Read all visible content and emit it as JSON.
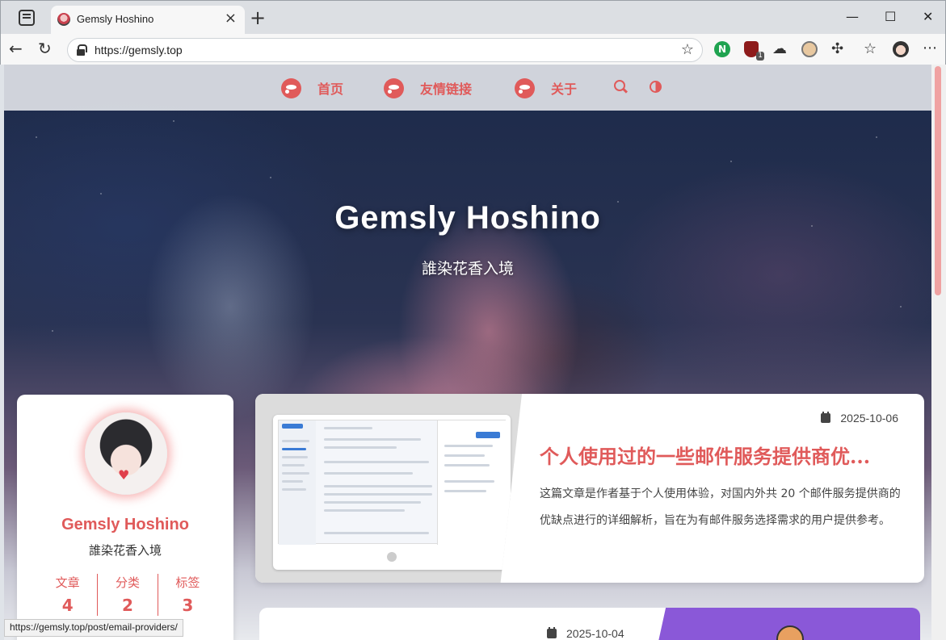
{
  "browser": {
    "tab_title": "Gemsly Hoshino",
    "url": "https://gemsly.top",
    "status_url": "https://gemsly.top/post/email-providers/",
    "ublock_count": "1",
    "icons": [
      "tab-actions-icon",
      "close-icon",
      "plus-icon",
      "minimize-icon",
      "maximize-icon",
      "close-window-icon",
      "back-icon",
      "reload-icon",
      "lock-icon",
      "star-icon",
      "extensions-icon",
      "favorites-icon",
      "more-icon"
    ]
  },
  "nav": {
    "items": [
      {
        "label": "首页"
      },
      {
        "label": "友情链接"
      },
      {
        "label": "关于"
      }
    ],
    "accent": "#e05a5a"
  },
  "hero": {
    "title": "Gemsly Hoshino",
    "subtitle": "誰染花香入境"
  },
  "profile": {
    "name": "Gemsly Hoshino",
    "desc": "誰染花香入境",
    "stats": [
      {
        "label": "文章",
        "value": "4"
      },
      {
        "label": "分类",
        "value": "2"
      },
      {
        "label": "标签",
        "value": "3"
      }
    ]
  },
  "posts": [
    {
      "date": "2025-10-06",
      "title": "个人使用过的一些邮件服务提供商优...",
      "excerpt": "这篇文章是作者基于个人使用体验，对国内外共 20 个邮件服务提供商的优缺点进行的详细解析，旨在为有邮件服务选择需求的用户提供参考。"
    },
    {
      "date": "2025-10-04"
    }
  ]
}
